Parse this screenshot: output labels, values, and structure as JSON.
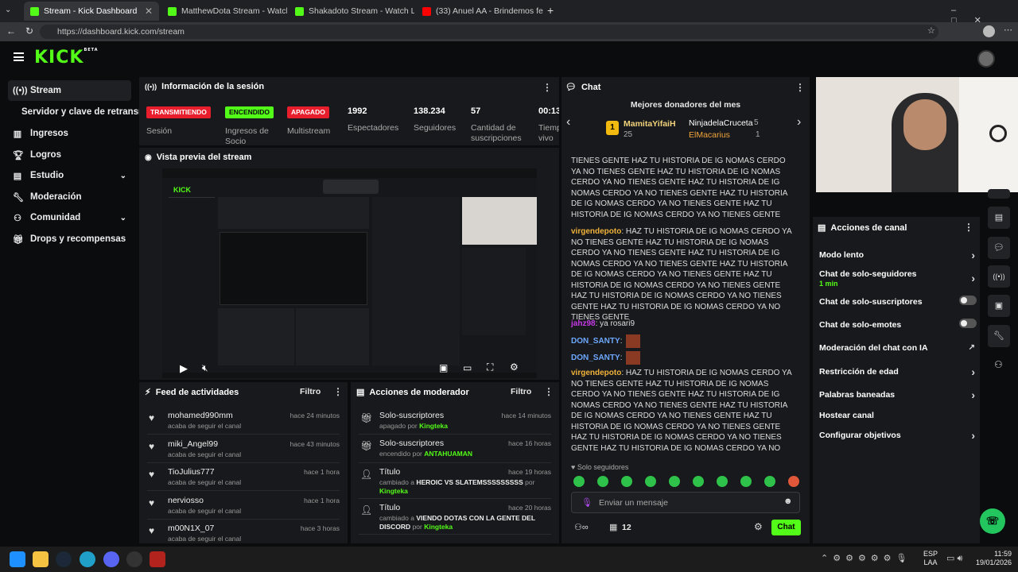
{
  "browser": {
    "tabs": [
      {
        "title": "Stream - Kick Dashboard",
        "color": "#53fc18"
      },
      {
        "title": "MatthewDota Stream - Watch Live",
        "color": "#53fc18"
      },
      {
        "title": "Shakadoto Stream - Watch Live or",
        "color": "#53fc18"
      },
      {
        "title": "(33) Anuel AA - Brindemos feat. O",
        "color": "#ff0000"
      }
    ],
    "url": "https://dashboard.kick.com/stream"
  },
  "header": {
    "logo": "KICK",
    "beta": "BETA"
  },
  "sidebar": {
    "items": [
      {
        "label": "Stream",
        "icon": "broadcast-icon"
      },
      {
        "label": "Servidor y clave de retransm",
        "icon": ""
      },
      {
        "label": "Ingresos",
        "icon": "bar-chart-icon"
      },
      {
        "label": "Logros",
        "icon": "trophy-icon"
      },
      {
        "label": "Estudio",
        "icon": "studio-icon"
      },
      {
        "label": "Moderación",
        "icon": "wrench-icon"
      },
      {
        "label": "Comunidad",
        "icon": "community-icon"
      },
      {
        "label": "Drops y recompensas",
        "icon": "gift-icon"
      }
    ]
  },
  "session": {
    "title": "Información de la sesión",
    "badges": [
      {
        "text": "TRANSMITIENDO",
        "label": "Sesión",
        "bg": "#e91e2d",
        "fg": "#ffffff"
      },
      {
        "text": "ENCENDIDO",
        "label": "Ingresos de Socio",
        "bg": "#53fc18",
        "fg": "#0b0c0e"
      },
      {
        "text": "APAGADO",
        "label": "Multistream",
        "bg": "#e91e2d",
        "fg": "#ffffff"
      }
    ],
    "stats": [
      {
        "value": "1992",
        "label": "Espectadores"
      },
      {
        "value": "138.234",
        "label": "Seguidores"
      },
      {
        "value": "57",
        "label": "Cantidad de suscripciones"
      },
      {
        "value": "00:13",
        "label": "Tiempo en vivo"
      }
    ]
  },
  "preview": {
    "title": "Vista previa del stream"
  },
  "activity": {
    "title": "Feed de actividades",
    "filter": "Filtro",
    "items": [
      {
        "name": "mohamed990mm",
        "sub": "acaba de seguir el canal",
        "time": "hace 24 minutos"
      },
      {
        "name": "miki_Angel99",
        "sub": "acaba de seguir el canal",
        "time": "hace 43 minutos"
      },
      {
        "name": "TioJulius777",
        "sub": "acaba de seguir el canal",
        "time": "hace 1 hora"
      },
      {
        "name": "nerviosso",
        "sub": "acaba de seguir el canal",
        "time": "hace 1 hora"
      },
      {
        "name": "m00N1X_07",
        "sub": "acaba de seguir el canal",
        "time": "hace 3 horas"
      }
    ]
  },
  "modactions": {
    "title": "Acciones de moderador",
    "filter": "Filtro",
    "items": [
      {
        "name": "Solo-suscriptores",
        "pre": "apagado por ",
        "who": "Kingteka",
        "time": "hace 14 minutos",
        "icon": "gift-icon"
      },
      {
        "name": "Solo-suscriptores",
        "pre": "encendido por ",
        "who": "ANTAHUAMAN",
        "time": "hace 16 horas",
        "icon": "gift-icon"
      },
      {
        "name": "Título",
        "pre": "cambiado a ",
        "bold": "HEROIC VS SLATEMSSSSSSSSS",
        "post": " por ",
        "who": "Kingteka",
        "time": "hace 19 horas",
        "icon": "user-edit-icon"
      },
      {
        "name": "Título",
        "pre": "cambiado a ",
        "bold": "VIENDO DOTAS CON LA GENTE DEL DISCORD",
        "post": " por ",
        "who": "Kingteka",
        "time": "hace 20 horas",
        "icon": "user-edit-icon"
      }
    ]
  },
  "chat": {
    "title": "Chat",
    "donors_title": "Mejores donadores del mes",
    "donors": [
      {
        "rank": "1",
        "name": "MamitaYifaiH",
        "count": "25"
      },
      {
        "name": "NinjadelaCruceta",
        "count": "5"
      },
      {
        "name": "ElMacarius",
        "count": "1"
      }
    ],
    "messages": [
      {
        "user": "",
        "text": "TIENES GENTE HAZ TU HISTORIA DE IG NOMAS CERDO YA NO TIENES GENTE HAZ TU HISTORIA DE IG NOMAS CERDO YA NO TIENES GENTE HAZ TU HISTORIA DE IG NOMAS CERDO YA NO TIENES GENTE HAZ TU HISTORIA DE IG NOMAS CERDO YA NO TIENES GENTE HAZ TU HISTORIA DE IG NOMAS CERDO YA NO TIENES GENTE"
      },
      {
        "user": "virgendepoto",
        "text": "HAZ TU HISTORIA DE IG NOMAS CERDO YA NO TIENES GENTE HAZ TU HISTORIA DE IG NOMAS CERDO YA NO TIENES GENTE HAZ TU HISTORIA DE IG NOMAS CERDO YA NO TIENES GENTE HAZ TU HISTORIA DE IG NOMAS CERDO YA NO TIENES GENTE HAZ TU HISTORIA DE IG NOMAS CERDO YA NO TIENES GENTE HAZ TU HISTORIA DE IG NOMAS CERDO YA NO TIENES GENTE HAZ TU HISTORIA DE IG NOMAS CERDO YA NO TIENES GENTE"
      },
      {
        "user": "jahz98",
        "text": "ya rosari9"
      },
      {
        "user": "DON_SANTY",
        "text": ""
      },
      {
        "user": "DON_SANTY",
        "text": ""
      },
      {
        "user": "virgendepoto",
        "text": "HAZ TU HISTORIA DE IG NOMAS CERDO YA NO TIENES GENTE HAZ TU HISTORIA DE IG NOMAS CERDO YA NO TIENES GENTE HAZ TU HISTORIA DE IG NOMAS CERDO YA NO TIENES GENTE HAZ TU HISTORIA DE IG NOMAS CERDO YA NO TIENES GENTE HAZ TU HISTORIA DE IG NOMAS CERDO YA NO TIENES GENTE HAZ TU HISTORIA DE IG NOMAS CERDO YA NO TIENES GENTE HAZ TU HISTORIA DE IG NOMAS CERDO YA NO TIENES GENTE"
      }
    ],
    "followers_only": "Solo seguidores",
    "placeholder": "Enviar un mensaje",
    "viewer_count": "12",
    "send": "Chat"
  },
  "channel_actions": {
    "title": "Acciones de canal",
    "items": [
      {
        "label": "Modo lento",
        "kind": "chevron"
      },
      {
        "label": "Chat de solo-seguidores",
        "sub": "1 min",
        "kind": "chevron"
      },
      {
        "label": "Chat de solo-suscriptores",
        "kind": "toggle"
      },
      {
        "label": "Chat de solo-emotes",
        "kind": "toggle"
      },
      {
        "label": "Moderación del chat con IA",
        "kind": "external"
      },
      {
        "label": "Restricción de edad",
        "kind": "chevron"
      },
      {
        "label": "Palabras baneadas",
        "kind": "chevron"
      },
      {
        "label": "Hostear canal",
        "kind": "none"
      },
      {
        "label": "Configurar objetivos",
        "kind": "chevron"
      }
    ]
  },
  "taskbar": {
    "lang": "ESP",
    "lang2": "LAA",
    "time": "11:59",
    "date": "19/01/2026"
  },
  "colors": {
    "accent": "#53fc18",
    "live": "#e91e2d",
    "panel": "#18191c"
  }
}
